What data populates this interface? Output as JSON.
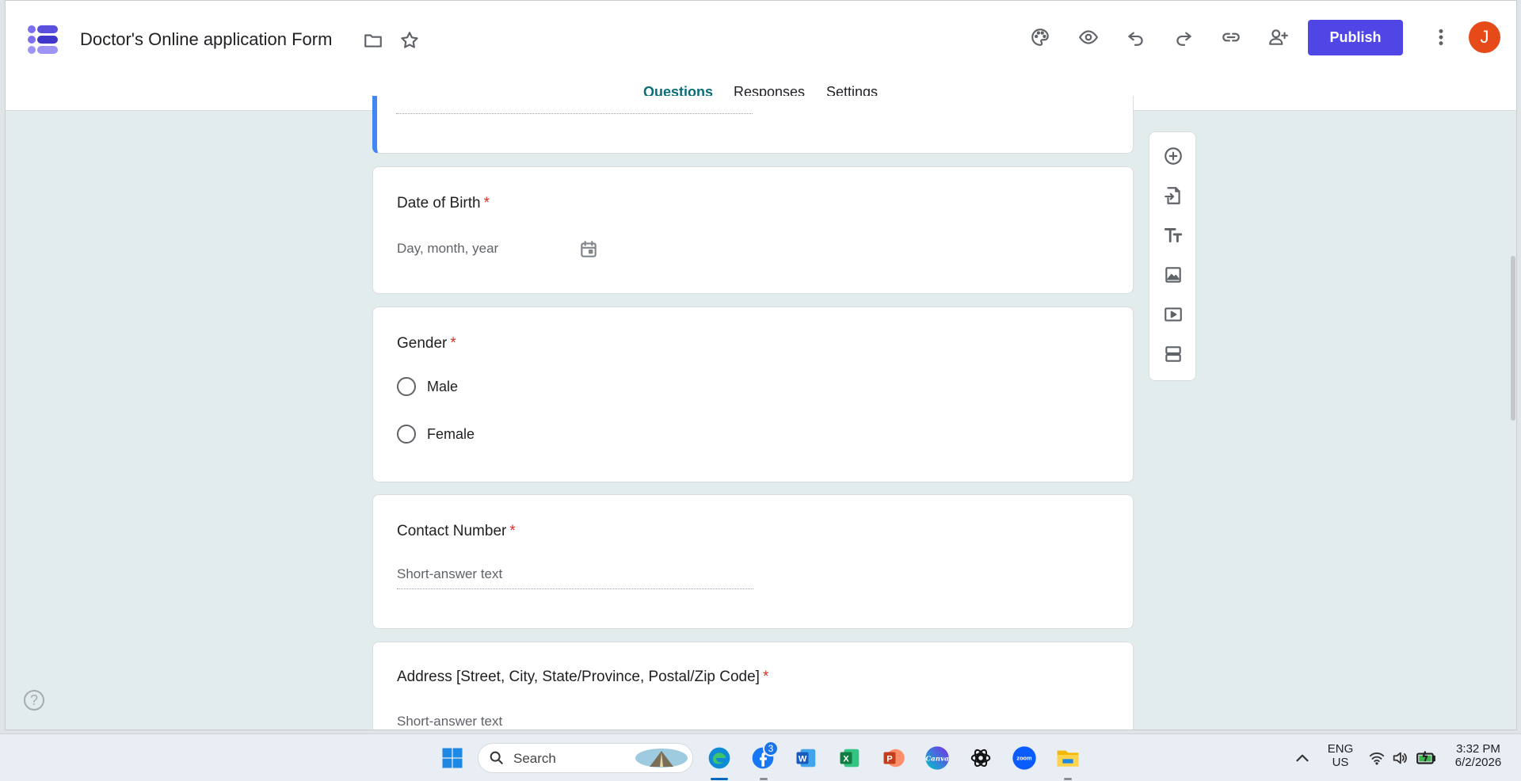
{
  "header": {
    "title": "Doctor's Online application Form",
    "publish_label": "Publish",
    "avatar_initial": "J",
    "accent_color": "#4f46e5"
  },
  "tabs": [
    {
      "label": "Questions",
      "active": true
    },
    {
      "label": "Responses",
      "active": false
    },
    {
      "label": "Settings",
      "active": false
    }
  ],
  "questions": {
    "dob": {
      "label": "Date of Birth",
      "required": "*",
      "placeholder": "Day, month, year"
    },
    "gender": {
      "label": "Gender",
      "required": "*",
      "options": [
        "Male",
        "Female"
      ]
    },
    "contact": {
      "label": "Contact Number",
      "required": "*",
      "placeholder": "Short-answer text"
    },
    "address": {
      "label": "Address [Street, City, State/Province, Postal/Zip Code]",
      "required": "*",
      "placeholder": "Short-answer text"
    }
  },
  "sidetools": [
    "add-question-icon",
    "import-questions-icon",
    "add-title-icon",
    "add-image-icon",
    "add-video-icon",
    "add-section-icon"
  ],
  "taskbar": {
    "search_placeholder": "Search",
    "notification_count": "3",
    "language": "ENG",
    "region": "US",
    "time": "3:32 PM",
    "date": "6/2/2026",
    "apps": [
      "windows-start-icon",
      "edge-icon",
      "facebook-icon",
      "word-icon",
      "excel-icon",
      "powerpoint-icon",
      "canva-icon",
      "chatgpt-icon",
      "zoom-icon",
      "file-explorer-icon"
    ]
  }
}
